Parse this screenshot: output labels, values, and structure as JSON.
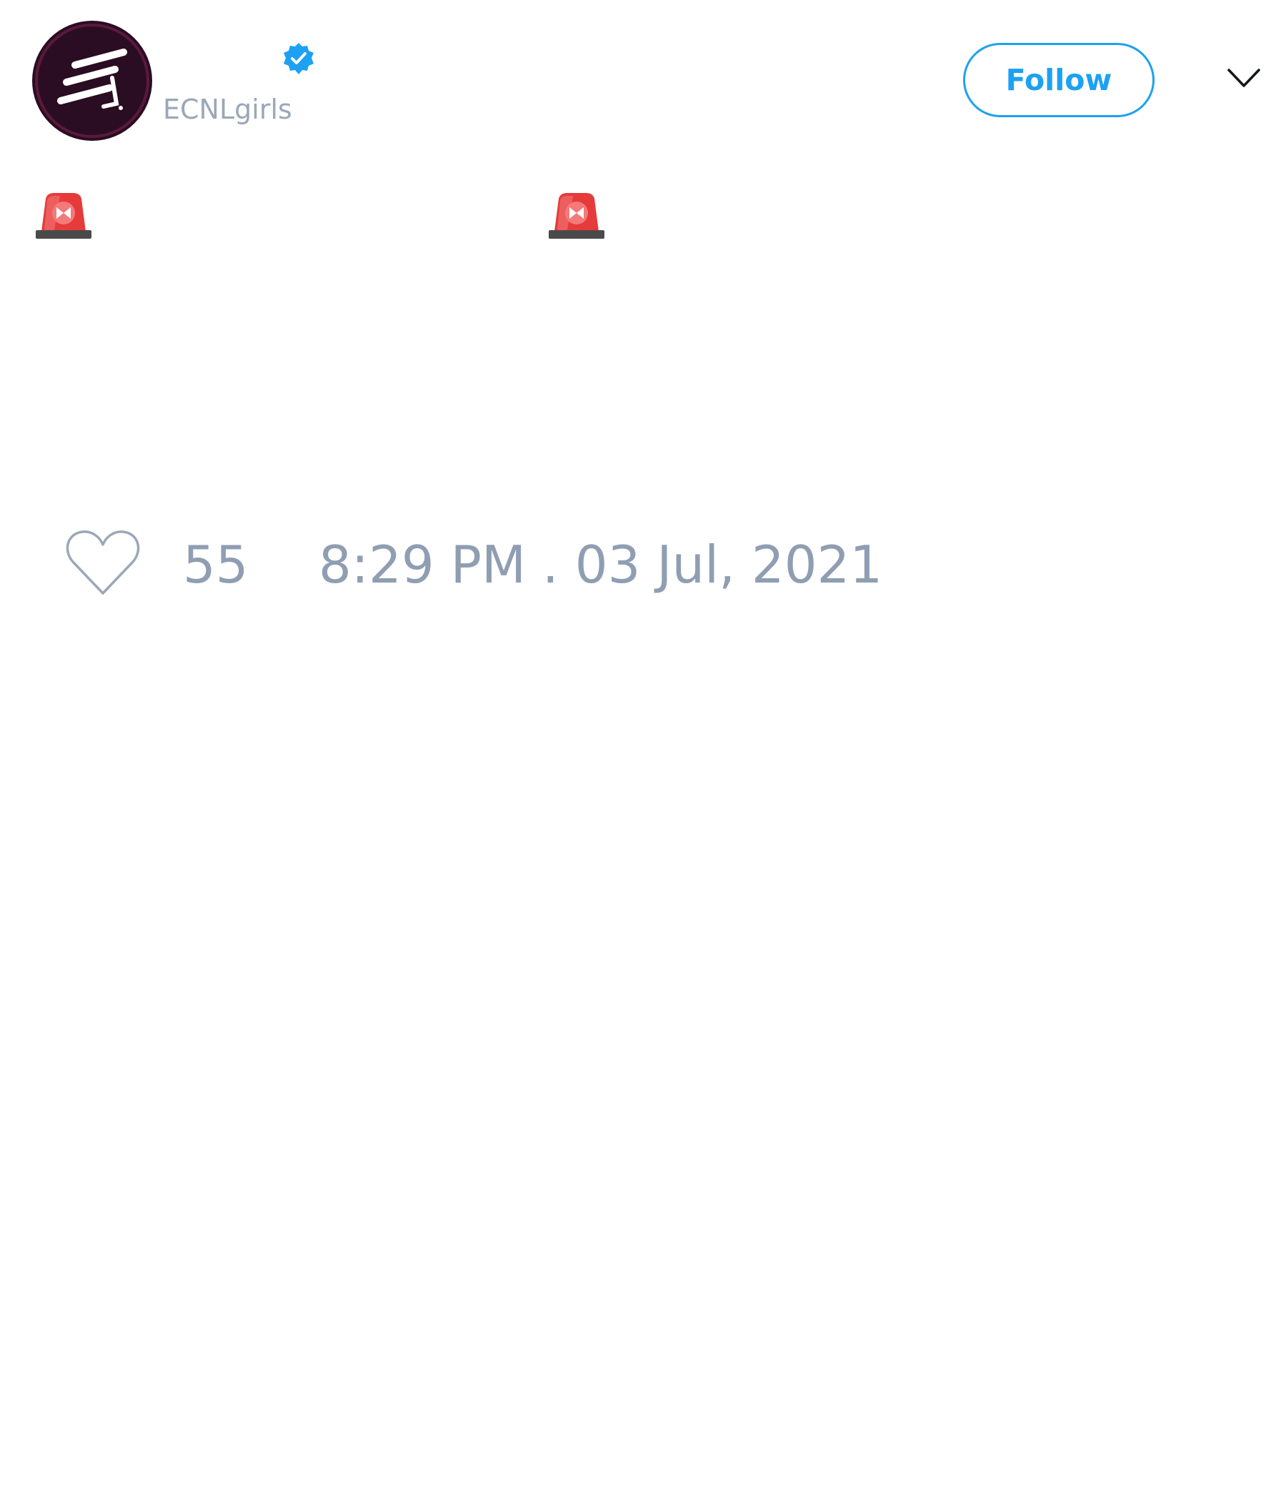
{
  "tweet": {
    "author": {
      "handle": "ECNLgirls",
      "verified": true,
      "avatar_icon": "ecnl-logo-icon",
      "avatar_colors": {
        "background": "#2a0d22",
        "ring": "#5a1a3c",
        "mark": "#ffffff"
      }
    },
    "follow_label": "Follow",
    "menu_icon": "chevron-down-icon",
    "body_icons": [
      "police-car-light-icon",
      "police-car-light-icon"
    ],
    "likes": {
      "icon": "heart-icon",
      "count": "55"
    },
    "timestamp": "8:29 PM . 03 Jul, 2021"
  },
  "colors": {
    "accent": "#1da1f2",
    "muted_text": "#8f9eb2",
    "siren_red": "#e53b3b",
    "siren_base": "#4a4a4a"
  }
}
